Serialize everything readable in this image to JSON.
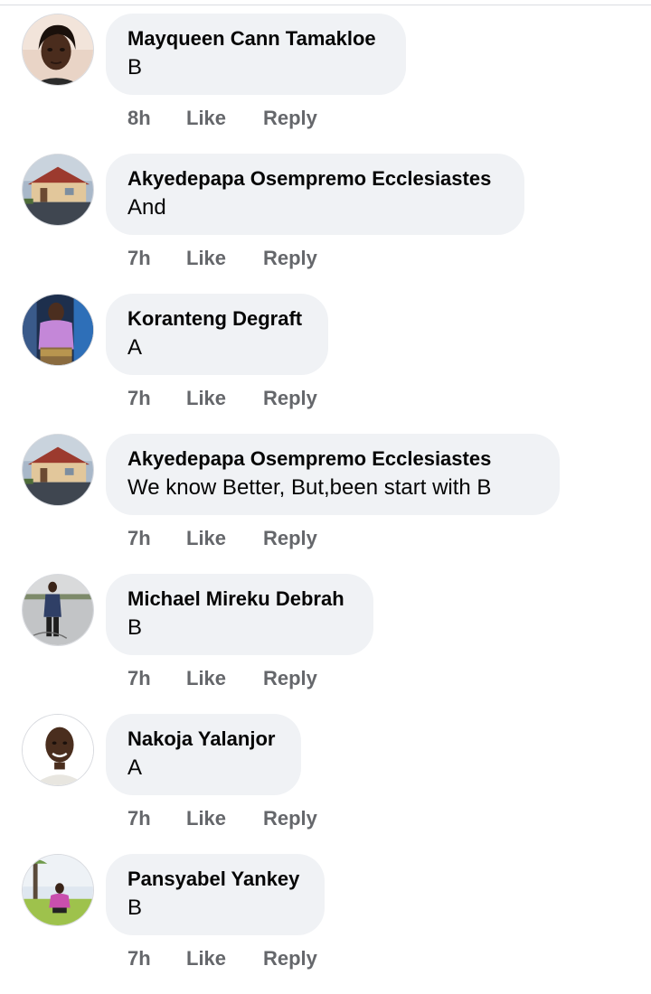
{
  "comments": [
    {
      "author": "Mayqueen Cann Tamakloe",
      "text": "B",
      "time": "8h",
      "like_label": "Like",
      "reply_label": "Reply"
    },
    {
      "author": "Akyedepapa Osempremo Ecclesiastes",
      "text": "And",
      "time": "7h",
      "like_label": "Like",
      "reply_label": "Reply"
    },
    {
      "author": "Koranteng Degraft",
      "text": "A",
      "time": "7h",
      "like_label": "Like",
      "reply_label": "Reply"
    },
    {
      "author": "Akyedepapa Osempremo Ecclesiastes",
      "text": "We know Better, But,been start with B",
      "time": "7h",
      "like_label": "Like",
      "reply_label": "Reply"
    },
    {
      "author": "Michael Mireku Debrah",
      "text": "B",
      "time": "7h",
      "like_label": "Like",
      "reply_label": "Reply"
    },
    {
      "author": "Nakoja Yalanjor",
      "text": "A",
      "time": "7h",
      "like_label": "Like",
      "reply_label": "Reply"
    },
    {
      "author": "Pansyabel Yankey",
      "text": "B",
      "time": "7h",
      "like_label": "Like",
      "reply_label": "Reply"
    }
  ],
  "colors": {
    "bubble_bg": "#f0f2f5",
    "author_text": "#050505",
    "meta_text": "#65676b"
  }
}
